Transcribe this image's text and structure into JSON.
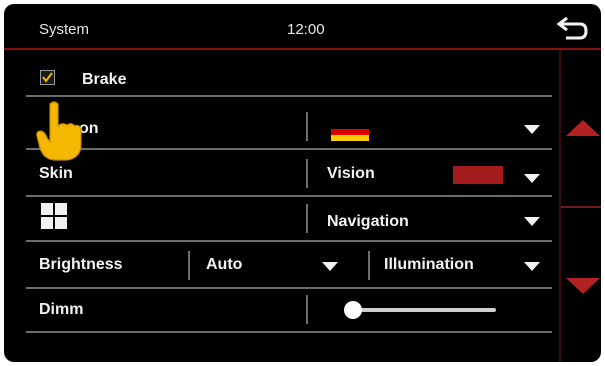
{
  "header": {
    "title": "System",
    "clock": "12:00"
  },
  "rows": {
    "brake": {
      "label": "Brake",
      "checked": true
    },
    "language": {
      "label_visible": "on",
      "flag": [
        "#000000",
        "#dd0000",
        "#ffce00"
      ]
    },
    "skin": {
      "label": "Skin",
      "vision_label": "Vision",
      "vision_color": "#a31b1b"
    },
    "nav": {
      "label": "Navigation"
    },
    "brightness": {
      "label": "Brightness",
      "mode": "Auto",
      "illumination_label": "Illumination"
    },
    "dimm": {
      "label": "Dimm",
      "level": 0
    }
  },
  "colors": {
    "accent": "#b32222",
    "background": "#000000",
    "text": "#f2f2f2",
    "divider": "#6c6c6c"
  }
}
